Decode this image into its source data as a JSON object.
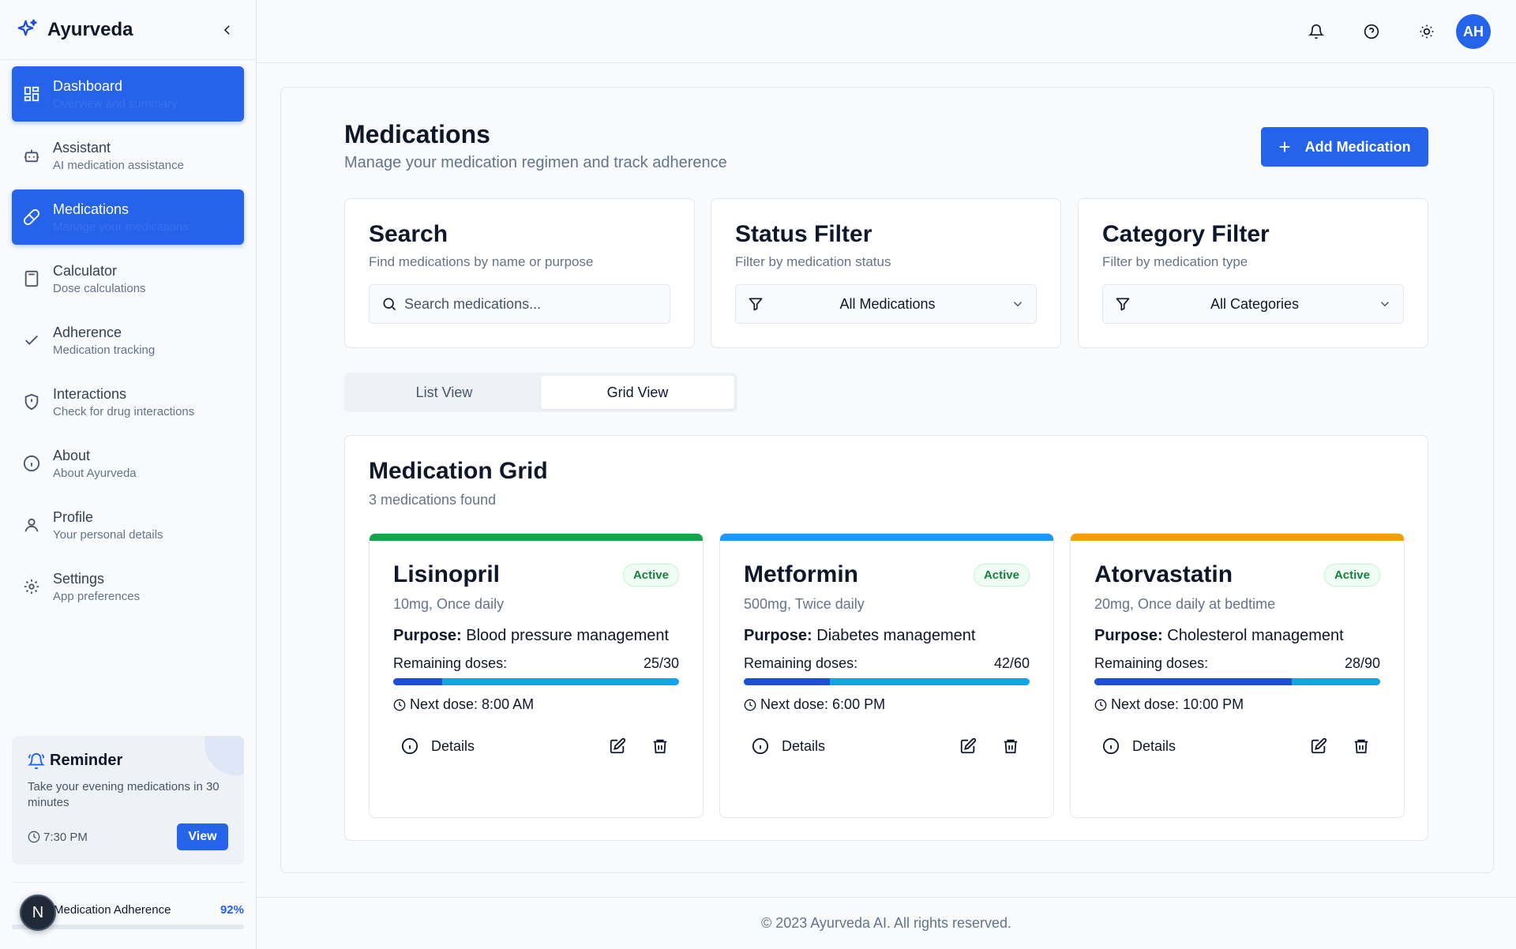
{
  "app": {
    "name": "Ayurveda"
  },
  "sidebar": {
    "items": [
      {
        "label": "Dashboard",
        "sub": "Overview and summary",
        "icon": "dashboard-icon",
        "active": true
      },
      {
        "label": "Assistant",
        "sub": "AI medication assistance",
        "icon": "bot-icon",
        "active": false
      },
      {
        "label": "Medications",
        "sub": "Manage your medications",
        "icon": "pill-icon",
        "active": true
      },
      {
        "label": "Calculator",
        "sub": "Dose calculations",
        "icon": "calculator-icon",
        "active": false
      },
      {
        "label": "Adherence",
        "sub": "Medication tracking",
        "icon": "check-icon",
        "active": false
      },
      {
        "label": "Interactions",
        "sub": "Check for drug interactions",
        "icon": "shield-icon",
        "active": false
      },
      {
        "label": "About",
        "sub": "About Ayurveda",
        "icon": "info-icon",
        "active": false
      },
      {
        "label": "Profile",
        "sub": "Your personal details",
        "icon": "user-icon",
        "active": false
      },
      {
        "label": "Settings",
        "sub": "App preferences",
        "icon": "gear-icon",
        "active": false
      }
    ],
    "reminder": {
      "title": "Reminder",
      "message": "Take your evening medications in 30 minutes",
      "time": "7:30 PM",
      "button": "View"
    },
    "adherence": {
      "label": "Medication Adherence",
      "value": "92%"
    },
    "badge": "N"
  },
  "topbar": {
    "avatar": "AH"
  },
  "page": {
    "title": "Medications",
    "subtitle": "Manage your medication regimen and track adherence",
    "add_button": "Add Medication"
  },
  "filters": {
    "search": {
      "title": "Search",
      "sub": "Find medications by name or purpose",
      "placeholder": "Search medications..."
    },
    "status": {
      "title": "Status Filter",
      "sub": "Filter by medication status",
      "value": "All Medications"
    },
    "category": {
      "title": "Category Filter",
      "sub": "Filter by medication type",
      "value": "All Categories"
    }
  },
  "tabs": {
    "list": "List View",
    "grid": "Grid View",
    "active": "grid"
  },
  "grid": {
    "title": "Medication Grid",
    "count": "3 medications found",
    "purpose_label": "Purpose:",
    "remaining_label": "Remaining doses:",
    "details_label": "Details",
    "meds": [
      {
        "name": "Lisinopril",
        "status": "Active",
        "dose": "10mg, Once daily",
        "purpose": "Blood pressure management",
        "remaining": "25/30",
        "remaining_fraction": 0.17,
        "next": "Next dose: 8:00 AM",
        "color": "#16a34a"
      },
      {
        "name": "Metformin",
        "status": "Active",
        "dose": "500mg, Twice daily",
        "purpose": "Diabetes management",
        "remaining": "42/60",
        "remaining_fraction": 0.3,
        "next": "Next dose: 6:00 PM",
        "color": "#2196f3"
      },
      {
        "name": "Atorvastatin",
        "status": "Active",
        "dose": "20mg, Once daily at bedtime",
        "purpose": "Cholesterol management",
        "remaining": "28/90",
        "remaining_fraction": 0.69,
        "next": "Next dose: 10:00 PM",
        "color": "#f59e0b"
      }
    ]
  },
  "footer": "© 2023 Ayurveda AI. All rights reserved."
}
